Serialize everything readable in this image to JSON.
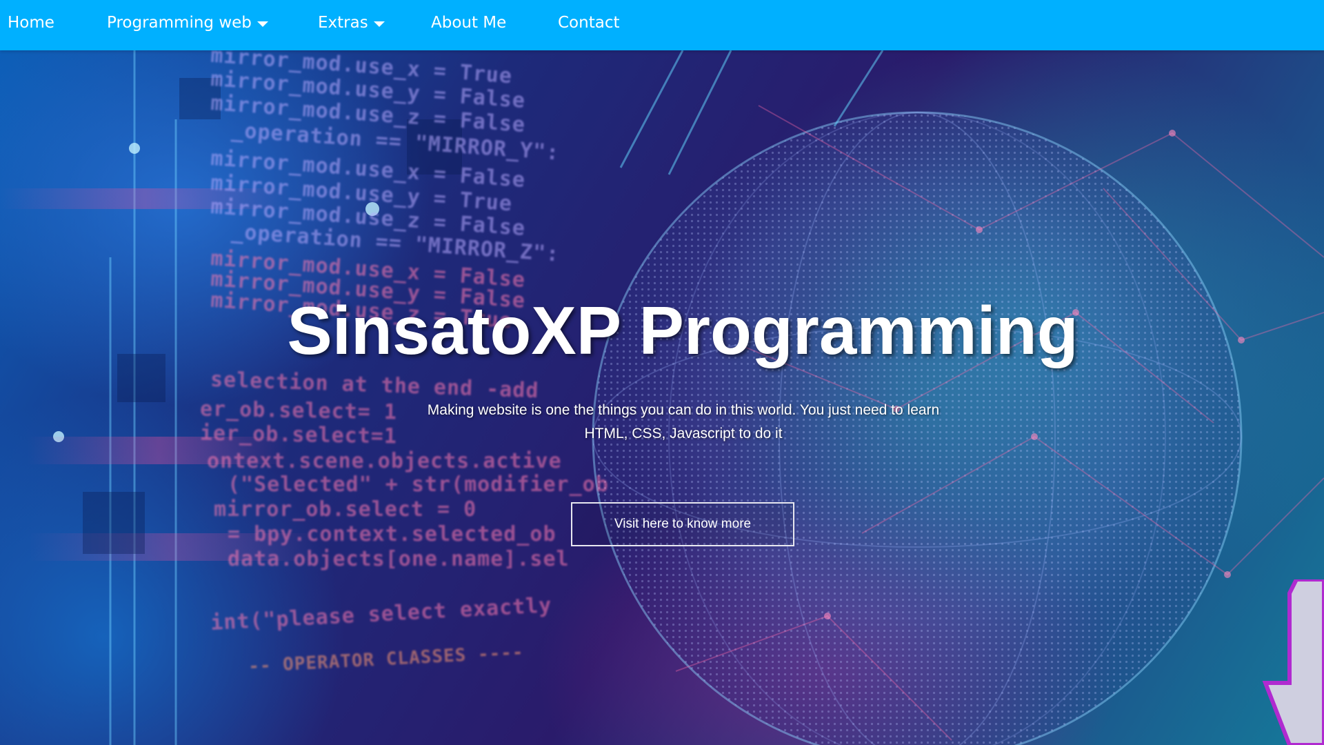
{
  "nav": {
    "items": [
      {
        "label": "Home",
        "has_dropdown": false
      },
      {
        "label": "Programming web",
        "has_dropdown": true
      },
      {
        "label": "Extras",
        "has_dropdown": true
      },
      {
        "label": "About Me",
        "has_dropdown": false
      },
      {
        "label": "Contact",
        "has_dropdown": false
      }
    ],
    "bar_color": "#00b0ff"
  },
  "hero": {
    "title": "SinsatoXP Programming",
    "subtitle_line1": "Making website is one the things you can do in this world. You just need to learn",
    "subtitle_line2": "HTML, CSS, Javascript to do it",
    "button_label": "Visit here to know more",
    "background_code": [
      "mirror_mod.use_x = True",
      "mirror_mod.use_y = False",
      "mirror_mod.use_z = False",
      "_operation == \"MIRROR_Y\":",
      "mirror_mod.use_x = False",
      "mirror_mod.use_y = True",
      "mirror_mod.use_z = False",
      "_operation == \"MIRROR_Z\":",
      "mirror_mod.use_x = False",
      "mirror_mod.use_y = False",
      "mirror_mod.use_z = True",
      "selection at the end -add",
      "er_ob.select= 1",
      "ier_ob.select=1",
      "ontext.scene.objects.active",
      "(\"Selected\" + str(modifier_ob",
      "mirror_ob.select = 0",
      "= bpy.context.selected_ob",
      "data.objects[one.name].sel",
      "int(\"please select exactly",
      "-- OPERATOR CLASSES ----"
    ]
  }
}
